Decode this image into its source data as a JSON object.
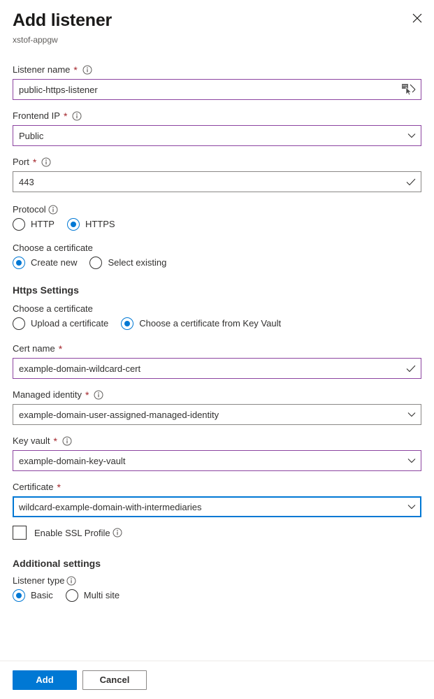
{
  "header": {
    "title": "Add listener",
    "subtitle": "xstof-appgw",
    "close_label": "close-icon"
  },
  "fields": {
    "listener_name": {
      "label": "Listener name",
      "required": true,
      "has_info": true,
      "value": "public-https-listener",
      "placeholder": "",
      "adorn": "cursor-check",
      "border": "violet"
    },
    "frontend_ip": {
      "label": "Frontend IP",
      "required": true,
      "has_info": true,
      "value": "Public",
      "adorn": "chevron-down",
      "border": "violet"
    },
    "port": {
      "label": "Port",
      "required": true,
      "has_info": true,
      "value": "443",
      "adorn": "check",
      "border": "gray"
    },
    "cert_name": {
      "label": "Cert name",
      "required": true,
      "has_info": false,
      "value": "example-domain-wildcard-cert",
      "adorn": "check",
      "border": "violet"
    },
    "managed_identity": {
      "label": "Managed identity",
      "required": true,
      "has_info": true,
      "value": "example-domain-user-assigned-managed-identity",
      "adorn": "chevron-down",
      "border": "gray"
    },
    "key_vault": {
      "label": "Key vault",
      "required": true,
      "has_info": true,
      "value": "example-domain-key-vault",
      "adorn": "chevron-down",
      "border": "violet"
    },
    "certificate": {
      "label": "Certificate",
      "required": true,
      "has_info": false,
      "value": "wildcard-example-domain-with-intermediaries",
      "adorn": "chevron-down",
      "border": "blue"
    }
  },
  "protocol": {
    "label": "Protocol",
    "has_info": true,
    "options": [
      "HTTP",
      "HTTPS"
    ],
    "selected": "HTTPS"
  },
  "choose_certificate_top": {
    "label": "Choose a certificate",
    "has_info": false,
    "options": [
      "Create new",
      "Select existing"
    ],
    "selected": "Create new"
  },
  "https_settings": {
    "heading": "Https Settings",
    "choose_certificate": {
      "label": "Choose a certificate",
      "has_info": false,
      "options": [
        "Upload a certificate",
        "Choose a certificate from Key Vault"
      ],
      "selected": "Choose a certificate from Key Vault"
    },
    "enable_ssl_profile": {
      "label": "Enable SSL Profile",
      "has_info": true,
      "checked": false
    }
  },
  "additional_settings": {
    "heading": "Additional settings",
    "listener_type": {
      "label": "Listener type",
      "has_info": true,
      "options": [
        "Basic",
        "Multi site"
      ],
      "selected": "Basic"
    }
  },
  "footer": {
    "add_label": "Add",
    "cancel_label": "Cancel"
  },
  "colors": {
    "accent": "#0078d4",
    "required_asterisk": "#a4262c",
    "violet_border": "#8c44a0",
    "gray_border": "#8a8886"
  }
}
